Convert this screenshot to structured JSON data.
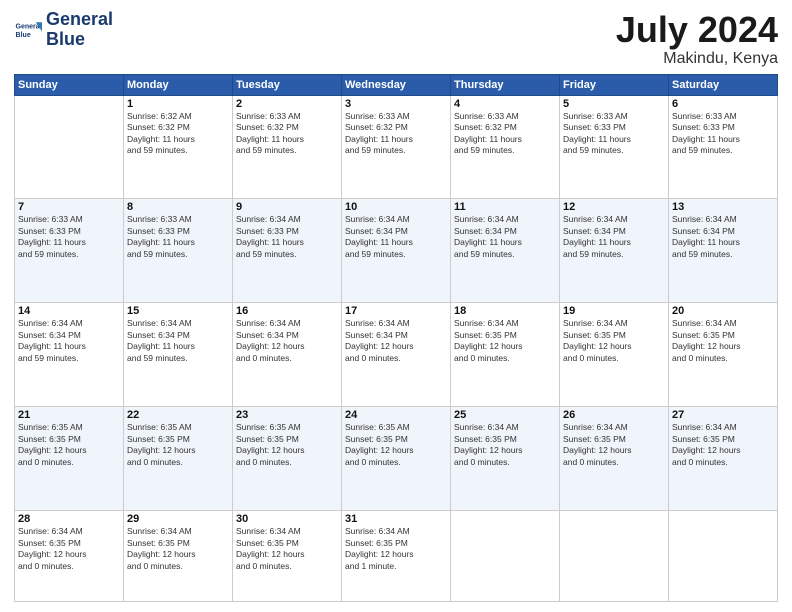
{
  "header": {
    "logo_line1": "General",
    "logo_line2": "Blue",
    "month": "July 2024",
    "location": "Makindu, Kenya"
  },
  "days_of_week": [
    "Sunday",
    "Monday",
    "Tuesday",
    "Wednesday",
    "Thursday",
    "Friday",
    "Saturday"
  ],
  "weeks": [
    [
      {
        "day": "",
        "info": ""
      },
      {
        "day": "1",
        "info": "Sunrise: 6:32 AM\nSunset: 6:32 PM\nDaylight: 11 hours\nand 59 minutes."
      },
      {
        "day": "2",
        "info": "Sunrise: 6:33 AM\nSunset: 6:32 PM\nDaylight: 11 hours\nand 59 minutes."
      },
      {
        "day": "3",
        "info": "Sunrise: 6:33 AM\nSunset: 6:32 PM\nDaylight: 11 hours\nand 59 minutes."
      },
      {
        "day": "4",
        "info": "Sunrise: 6:33 AM\nSunset: 6:32 PM\nDaylight: 11 hours\nand 59 minutes."
      },
      {
        "day": "5",
        "info": "Sunrise: 6:33 AM\nSunset: 6:33 PM\nDaylight: 11 hours\nand 59 minutes."
      },
      {
        "day": "6",
        "info": "Sunrise: 6:33 AM\nSunset: 6:33 PM\nDaylight: 11 hours\nand 59 minutes."
      }
    ],
    [
      {
        "day": "7",
        "info": "Sunrise: 6:33 AM\nSunset: 6:33 PM\nDaylight: 11 hours\nand 59 minutes."
      },
      {
        "day": "8",
        "info": "Sunrise: 6:33 AM\nSunset: 6:33 PM\nDaylight: 11 hours\nand 59 minutes."
      },
      {
        "day": "9",
        "info": "Sunrise: 6:34 AM\nSunset: 6:33 PM\nDaylight: 11 hours\nand 59 minutes."
      },
      {
        "day": "10",
        "info": "Sunrise: 6:34 AM\nSunset: 6:34 PM\nDaylight: 11 hours\nand 59 minutes."
      },
      {
        "day": "11",
        "info": "Sunrise: 6:34 AM\nSunset: 6:34 PM\nDaylight: 11 hours\nand 59 minutes."
      },
      {
        "day": "12",
        "info": "Sunrise: 6:34 AM\nSunset: 6:34 PM\nDaylight: 11 hours\nand 59 minutes."
      },
      {
        "day": "13",
        "info": "Sunrise: 6:34 AM\nSunset: 6:34 PM\nDaylight: 11 hours\nand 59 minutes."
      }
    ],
    [
      {
        "day": "14",
        "info": "Sunrise: 6:34 AM\nSunset: 6:34 PM\nDaylight: 11 hours\nand 59 minutes."
      },
      {
        "day": "15",
        "info": "Sunrise: 6:34 AM\nSunset: 6:34 PM\nDaylight: 11 hours\nand 59 minutes."
      },
      {
        "day": "16",
        "info": "Sunrise: 6:34 AM\nSunset: 6:34 PM\nDaylight: 12 hours\nand 0 minutes."
      },
      {
        "day": "17",
        "info": "Sunrise: 6:34 AM\nSunset: 6:34 PM\nDaylight: 12 hours\nand 0 minutes."
      },
      {
        "day": "18",
        "info": "Sunrise: 6:34 AM\nSunset: 6:35 PM\nDaylight: 12 hours\nand 0 minutes."
      },
      {
        "day": "19",
        "info": "Sunrise: 6:34 AM\nSunset: 6:35 PM\nDaylight: 12 hours\nand 0 minutes."
      },
      {
        "day": "20",
        "info": "Sunrise: 6:34 AM\nSunset: 6:35 PM\nDaylight: 12 hours\nand 0 minutes."
      }
    ],
    [
      {
        "day": "21",
        "info": "Sunrise: 6:35 AM\nSunset: 6:35 PM\nDaylight: 12 hours\nand 0 minutes."
      },
      {
        "day": "22",
        "info": "Sunrise: 6:35 AM\nSunset: 6:35 PM\nDaylight: 12 hours\nand 0 minutes."
      },
      {
        "day": "23",
        "info": "Sunrise: 6:35 AM\nSunset: 6:35 PM\nDaylight: 12 hours\nand 0 minutes."
      },
      {
        "day": "24",
        "info": "Sunrise: 6:35 AM\nSunset: 6:35 PM\nDaylight: 12 hours\nand 0 minutes."
      },
      {
        "day": "25",
        "info": "Sunrise: 6:34 AM\nSunset: 6:35 PM\nDaylight: 12 hours\nand 0 minutes."
      },
      {
        "day": "26",
        "info": "Sunrise: 6:34 AM\nSunset: 6:35 PM\nDaylight: 12 hours\nand 0 minutes."
      },
      {
        "day": "27",
        "info": "Sunrise: 6:34 AM\nSunset: 6:35 PM\nDaylight: 12 hours\nand 0 minutes."
      }
    ],
    [
      {
        "day": "28",
        "info": "Sunrise: 6:34 AM\nSunset: 6:35 PM\nDaylight: 12 hours\nand 0 minutes."
      },
      {
        "day": "29",
        "info": "Sunrise: 6:34 AM\nSunset: 6:35 PM\nDaylight: 12 hours\nand 0 minutes."
      },
      {
        "day": "30",
        "info": "Sunrise: 6:34 AM\nSunset: 6:35 PM\nDaylight: 12 hours\nand 0 minutes."
      },
      {
        "day": "31",
        "info": "Sunrise: 6:34 AM\nSunset: 6:35 PM\nDaylight: 12 hours\nand 1 minute."
      },
      {
        "day": "",
        "info": ""
      },
      {
        "day": "",
        "info": ""
      },
      {
        "day": "",
        "info": ""
      }
    ]
  ]
}
